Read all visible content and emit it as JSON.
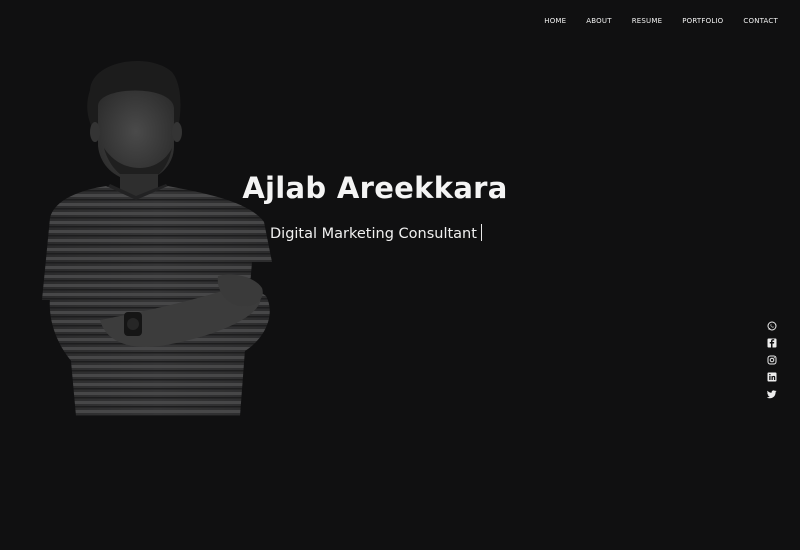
{
  "nav": {
    "items": [
      {
        "label": "HOME"
      },
      {
        "label": "ABOUT"
      },
      {
        "label": "RESUME"
      },
      {
        "label": "PORTFOLIO"
      },
      {
        "label": "CONTACT"
      }
    ]
  },
  "hero": {
    "name": "Ajlab Areekkara",
    "role": "Digital Marketing Consultant"
  },
  "social": {
    "icons": [
      "whatsapp-icon",
      "facebook-icon",
      "instagram-icon",
      "linkedin-icon",
      "twitter-icon"
    ]
  },
  "colors": {
    "background": "#101011",
    "text": "#f4f4f4"
  }
}
